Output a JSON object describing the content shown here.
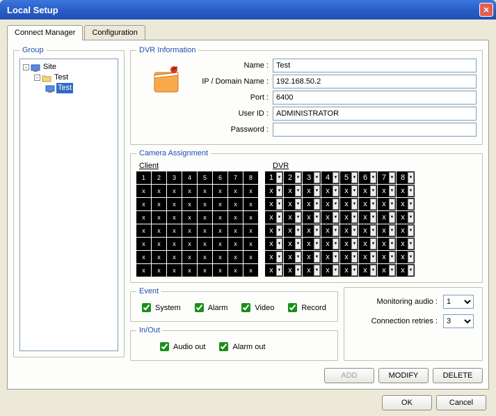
{
  "window": {
    "title": "Local Setup"
  },
  "tabs": {
    "connect": "Connect Manager",
    "config": "Configuration"
  },
  "group": {
    "legend": "Group",
    "tree": {
      "root": "Site",
      "child": "Test",
      "leaf": "Test"
    }
  },
  "dvr": {
    "legend": "DVR Information",
    "fields": {
      "name_label": "Name :",
      "name_value": "Test",
      "ip_label": "IP / Domain Name :",
      "ip_value": "192.168.50.2",
      "port_label": "Port :",
      "port_value": "6400",
      "user_label": "User ID :",
      "user_value": "ADMINISTRATOR",
      "pass_label": "Password :",
      "pass_value": ""
    }
  },
  "camera": {
    "legend": "Camera Assignment",
    "client_header": "Client",
    "dvr_header": "DVR",
    "client_first_row": [
      "1",
      "2",
      "3",
      "4",
      "5",
      "6",
      "7",
      "8"
    ],
    "dvr_first_row": [
      "1",
      "2",
      "3",
      "4",
      "5",
      "6",
      "7",
      "8"
    ],
    "x": "x"
  },
  "event": {
    "legend": "Event",
    "system": "System",
    "alarm": "Alarm",
    "video": "Video",
    "record": "Record"
  },
  "inout": {
    "legend": "In/Out",
    "audio": "Audio out",
    "alarm": "Alarm out"
  },
  "monitor": {
    "audio_label": "Monitoring audio :",
    "audio_value": "1",
    "retry_label": "Connection retries :",
    "retry_value": "3"
  },
  "buttons": {
    "add": "ADD",
    "modify": "MODIFY",
    "delete": "DELETE",
    "ok": "OK",
    "cancel": "Cancel"
  }
}
